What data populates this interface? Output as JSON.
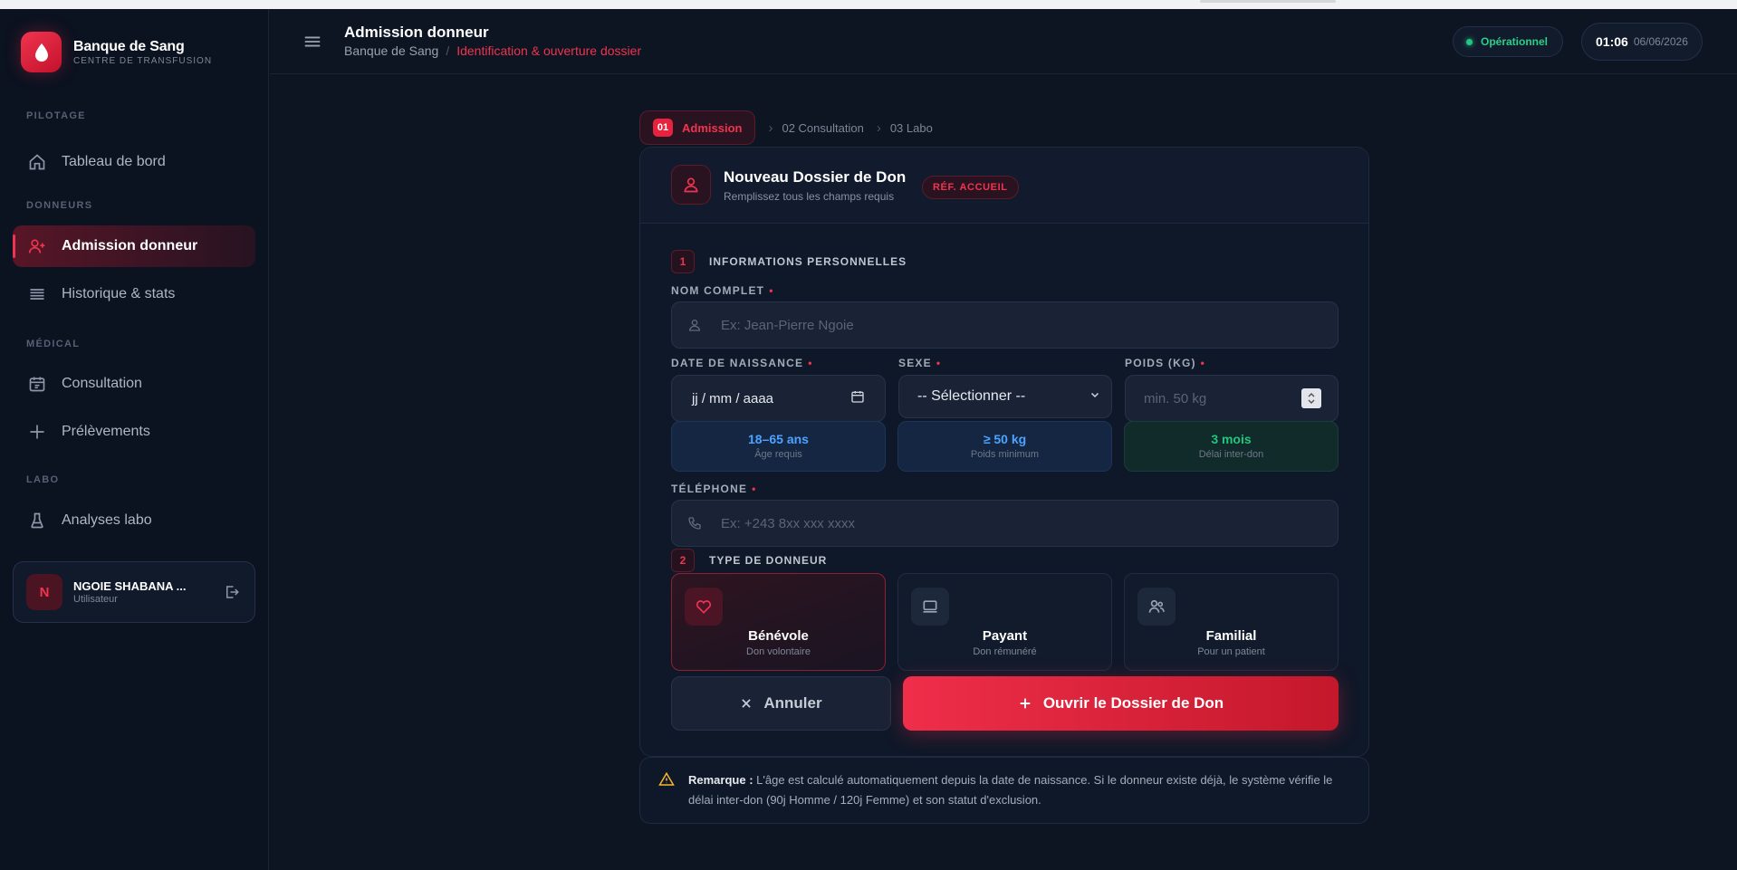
{
  "brand": {
    "title": "Banque de Sang",
    "subtitle": "CENTRE DE TRANSFUSION"
  },
  "sidebar": {
    "sections": [
      {
        "label": "PILOTAGE"
      },
      {
        "label": "DONNEURS"
      },
      {
        "label": "MÉDICAL"
      },
      {
        "label": "LABO"
      }
    ],
    "items": [
      {
        "label": "Tableau de bord",
        "icon": "home-icon"
      },
      {
        "label": "Admission donneur",
        "icon": "user-plus-icon",
        "active": true
      },
      {
        "label": "Historique & stats",
        "icon": "list-icon"
      },
      {
        "label": "Consultation",
        "icon": "calendar-icon"
      },
      {
        "label": "Prélèvements",
        "icon": "plus-icon"
      },
      {
        "label": "Analyses labo",
        "icon": "flask-icon"
      }
    ]
  },
  "user": {
    "initial": "N",
    "name": "NGOIE SHABANA ...",
    "role": "Utilisateur"
  },
  "header": {
    "title": "Admission donneur",
    "breadcrumb_root": "Banque de Sang",
    "breadcrumb_sep": "/",
    "breadcrumb_current": "Identification & ouverture dossier",
    "status": "Opérationnel",
    "time": "01:06",
    "date": "06/06/2026"
  },
  "stepper": {
    "active_num": "01",
    "active_label": "Admission",
    "step2": "02 Consultation",
    "step3": "03 Labo"
  },
  "form": {
    "title": "Nouveau Dossier de Don",
    "subtitle": "Remplissez tous les champs requis",
    "badge": "RÉF. ACCUEIL",
    "section1": {
      "num": "1",
      "title": "INFORMATIONS PERSONNELLES"
    },
    "nom": {
      "label": "NOM COMPLET",
      "placeholder": "Ex: Jean-Pierre Ngoie"
    },
    "dob": {
      "label": "DATE DE NAISSANCE",
      "value": "jj / mm / aaaa"
    },
    "sexe": {
      "label": "SEXE",
      "value": "-- Sélectionner --"
    },
    "poids": {
      "label": "POIDS (KG)",
      "placeholder": "min. 50 kg"
    },
    "info": [
      {
        "value": "18–65 ans",
        "label": "Âge requis",
        "color": "#4ea3ff"
      },
      {
        "value": "≥ 50 kg",
        "label": "Poids minimum",
        "color": "#4ea3ff"
      },
      {
        "value": "3 mois",
        "label": "Délai inter-don",
        "color": "#22c77f"
      }
    ],
    "tel": {
      "label": "TÉLÉPHONE",
      "placeholder": "Ex: +243 8xx xxx xxxx"
    },
    "required_mark": "•",
    "section2": {
      "num": "2",
      "title": "TYPE DE DONNEUR"
    },
    "types": [
      {
        "name": "Bénévole",
        "desc": "Don volontaire",
        "icon": "heart-icon",
        "active": true
      },
      {
        "name": "Payant",
        "desc": "Don rémunéré",
        "icon": "monitor-icon"
      },
      {
        "name": "Familial",
        "desc": "Pour un patient",
        "icon": "users-icon"
      }
    ],
    "cancel_label": "Annuler",
    "submit_label": "Ouvrir le Dossier de Don"
  },
  "note": {
    "strong": "Remarque :",
    "text": "L'âge est calculé automatiquement depuis la date de naissance. Si le donneur existe déjà, le système vérifie le délai inter-don (90j Homme / 120j Femme) et son statut d'exclusion."
  },
  "colors": {
    "accent": "#f0344f",
    "success": "#22c77f",
    "info": "#4ea3ff",
    "background": "#0d1422"
  }
}
